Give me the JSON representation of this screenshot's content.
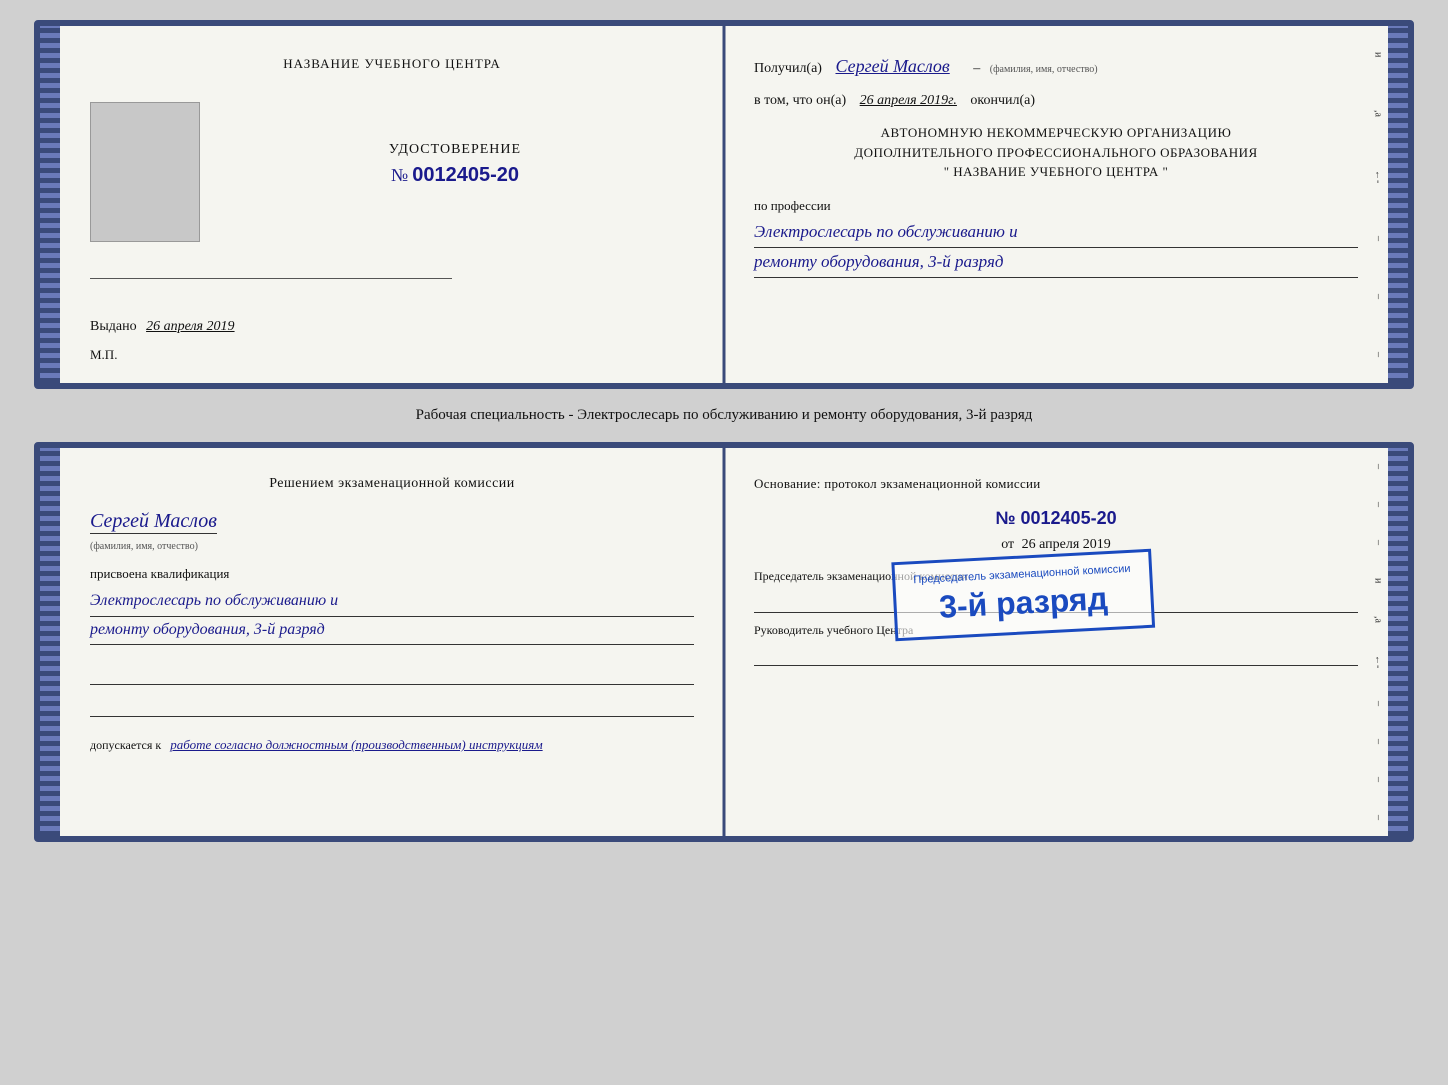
{
  "cert1": {
    "left": {
      "center_title": "НАЗВАНИЕ УЧЕБНОГО ЦЕНТРА",
      "photo_alt": "фото",
      "udostoverenie_label": "УДОСТОВЕРЕНИЕ",
      "number_prefix": "№",
      "number_value": "0012405-20",
      "vydano_label": "Выдано",
      "vydano_date": "26 апреля 2019",
      "mp_label": "М.П."
    },
    "right": {
      "poluchil_label": "Получил(а)",
      "recipient_name": "Сергей Маслов",
      "fio_hint": "(фамилия, имя, отчество)",
      "vtom_label": "в том, что он(а)",
      "date_completed": "26 апреля 2019г.",
      "okonchil_label": "окончил(а)",
      "org_line1": "АВТОНОМНУЮ НЕКОММЕРЧЕСКУЮ ОРГАНИЗАЦИЮ",
      "org_line2": "ДОПОЛНИТЕЛЬНОГО ПРОФЕССИОНАЛЬНОГО ОБРАЗОВАНИЯ",
      "org_line3": "\"  НАЗВАНИЕ УЧЕБНОГО ЦЕНТРА  \"",
      "po_professii_label": "по профессии",
      "profession_line1": "Электрослесарь по обслуживанию и",
      "profession_line2": "ремонту оборудования, 3-й разряд"
    }
  },
  "specialty_text": "Рабочая специальность - Электрослесарь по обслуживанию и ремонту оборудования, 3-й разряд",
  "cert2": {
    "left": {
      "commission_title": "Решением экзаменационной комиссии",
      "person_name": "Сергей Маслов",
      "fio_hint": "(фамилия, имя, отчество)",
      "assigned_label": "присвоена квалификация",
      "qual_line1": "Электрослесарь по обслуживанию и",
      "qual_line2": "ремонту оборудования, 3-й разряд",
      "allowed_label": "допускается к",
      "allowed_value": "работе согласно должностным (производственным) инструкциям"
    },
    "right": {
      "basis_label": "Основание: протокол экзаменационной комиссии",
      "number_prefix": "№",
      "number_value": "0012405-20",
      "date_prefix": "от",
      "date_value": "26 апреля 2019",
      "chairman_label": "Председатель экзаменационной комиссии",
      "head_label": "Руководитель учебного Центра"
    },
    "stamp": {
      "small_text": "Председатель экзаменационной комиссии",
      "main_text": "3-й разряд"
    }
  }
}
